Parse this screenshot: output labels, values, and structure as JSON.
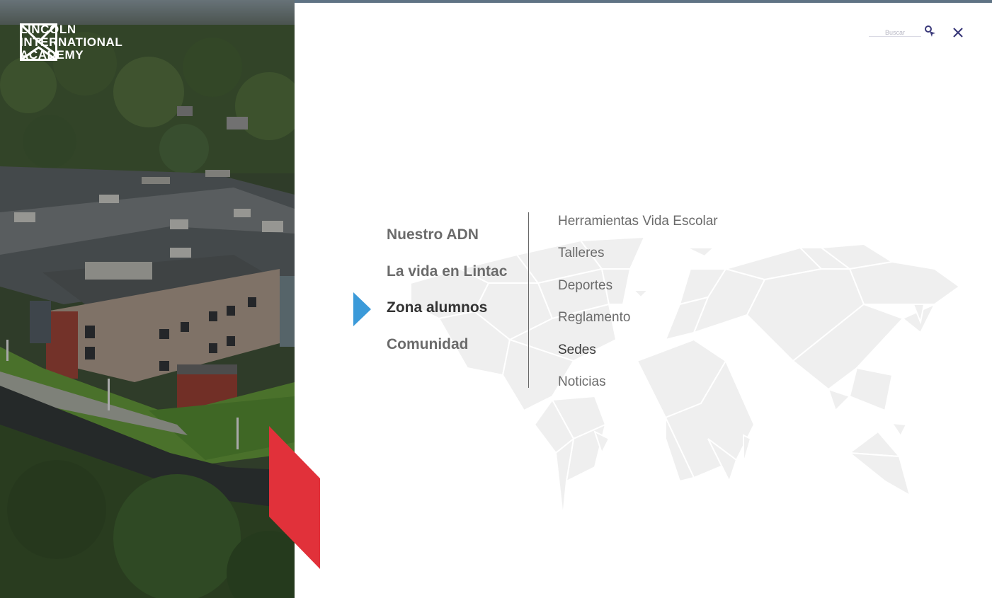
{
  "brand": {
    "line1": "LINCOLN",
    "line2": "INTERNATIONAL",
    "line3": "ACADEMY"
  },
  "search": {
    "placeholder": "Buscar",
    "icon": "search-icon"
  },
  "close": {
    "icon": "close-icon"
  },
  "main_nav": [
    {
      "label": "Nuestro ADN",
      "active": false
    },
    {
      "label": "La vida en Lintac",
      "active": false
    },
    {
      "label": "Zona alumnos",
      "active": true
    },
    {
      "label": "Comunidad",
      "active": false
    }
  ],
  "sub_nav": [
    {
      "label": "Herramientas Vida Escolar"
    },
    {
      "label": "Talleres"
    },
    {
      "label": "Deportes"
    },
    {
      "label": "Reglamento"
    },
    {
      "label": "Sedes"
    },
    {
      "label": "Noticias"
    }
  ],
  "colors": {
    "accent_blue": "#3b9ad9",
    "accent_red": "#e1313a",
    "icon_navy": "#3b3a7a",
    "map_gray": "#efefef"
  }
}
